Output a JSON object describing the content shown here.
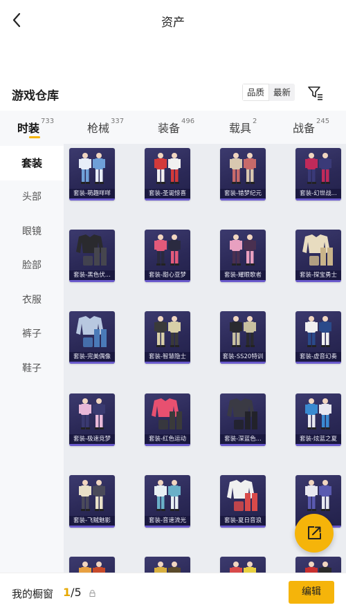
{
  "header": {
    "title": "资产"
  },
  "warehouse": {
    "title": "游戏仓库",
    "sort_options": [
      "品质",
      "最新"
    ],
    "active_sort": 0
  },
  "tabs": [
    {
      "label": "时装",
      "count": "733"
    },
    {
      "label": "枪械",
      "count": "337"
    },
    {
      "label": "装备",
      "count": "496"
    },
    {
      "label": "载具",
      "count": "2"
    },
    {
      "label": "战备",
      "count": "245"
    }
  ],
  "sidebar": {
    "items": [
      "套装",
      "头部",
      "眼镜",
      "脸部",
      "衣服",
      "裤子",
      "鞋子"
    ]
  },
  "items": [
    {
      "label": "套装-萌趣咩咩",
      "art": "pair",
      "colors": [
        "#e8eef8",
        "#6fa0d8"
      ]
    },
    {
      "label": "套装-圣诞惊喜",
      "art": "pair",
      "colors": [
        "#d33a3a",
        "#f0f0f0"
      ]
    },
    {
      "label": "套装-错梦纪元",
      "art": "pair",
      "colors": [
        "#d8c8b0",
        "#c86a6a"
      ]
    },
    {
      "label": "套装-幻世战...",
      "art": "pair",
      "colors": [
        "#c02a5a",
        "#3a3a78"
      ]
    },
    {
      "label": "套装-黑色伏...",
      "art": "jacket",
      "colors": [
        "#2a2a2e",
        "#46464e"
      ]
    },
    {
      "label": "套装-甜心亚梦",
      "art": "pair",
      "colors": [
        "#e35a7a",
        "#2a2a40"
      ]
    },
    {
      "label": "套装-耀眼歌者",
      "art": "pair",
      "colors": [
        "#e8a0c0",
        "#4a3050"
      ]
    },
    {
      "label": "套装-探宝勇士",
      "art": "jacket",
      "colors": [
        "#e8dcc0",
        "#c9b48a"
      ]
    },
    {
      "label": "套装-完美偶像",
      "art": "jacket",
      "colors": [
        "#b8c8e0",
        "#4a7ab8"
      ]
    },
    {
      "label": "套装-智慧隐士",
      "art": "pair",
      "colors": [
        "#3a3a3a",
        "#d8cfa8"
      ]
    },
    {
      "label": "套装-SS20特训",
      "art": "pair",
      "colors": [
        "#2a2a30",
        "#c8c0a0"
      ]
    },
    {
      "label": "套装-虚音幻奏",
      "art": "pair",
      "colors": [
        "#f0f0f0",
        "#2a4a8a"
      ]
    },
    {
      "label": "套装-极速竞梦",
      "art": "pair",
      "colors": [
        "#e8b8d8",
        "#3a3a70"
      ]
    },
    {
      "label": "套装-红色运动",
      "art": "jacket",
      "colors": [
        "#e85070",
        "#3a3a3a"
      ]
    },
    {
      "label": "套装-深蓝色...",
      "art": "jacket",
      "colors": [
        "#3a3a44",
        "#22222a"
      ]
    },
    {
      "label": "套装-炫蓝之夏",
      "art": "pair",
      "colors": [
        "#3a8ad0",
        "#e8e8f0"
      ]
    },
    {
      "label": "套装-飞贼魅影",
      "art": "pair",
      "colors": [
        "#e8e0c8",
        "#4a4a5a"
      ]
    },
    {
      "label": "套装-音速流光",
      "art": "pair",
      "colors": [
        "#e8f0f4",
        "#6ab0c8"
      ]
    },
    {
      "label": "套装-夏日音浪",
      "art": "jacket",
      "colors": [
        "#f0f0f0",
        "#d84a4a"
      ]
    },
    {
      "label": "",
      "art": "pair",
      "colors": [
        "#e8e8f0",
        "#5a5ab0"
      ]
    },
    {
      "label": "",
      "art": "pair",
      "colors": [
        "#e8a040",
        "#c84a2a"
      ]
    },
    {
      "label": "",
      "art": "pair",
      "colors": [
        "#d8b040",
        "#5a4a2a"
      ]
    },
    {
      "label": "",
      "art": "pair",
      "colors": [
        "#d84a4a",
        "#e8d040"
      ]
    },
    {
      "label": "",
      "art": "pair",
      "colors": [
        "#c83030",
        "#2a2a2a"
      ]
    }
  ],
  "bottom": {
    "showcase_label": "我的橱窗",
    "current": "1",
    "total": "/5",
    "edit_label": "编辑"
  },
  "colors": {
    "accent": "#f5b40a",
    "card_bg": "#2b2957"
  }
}
